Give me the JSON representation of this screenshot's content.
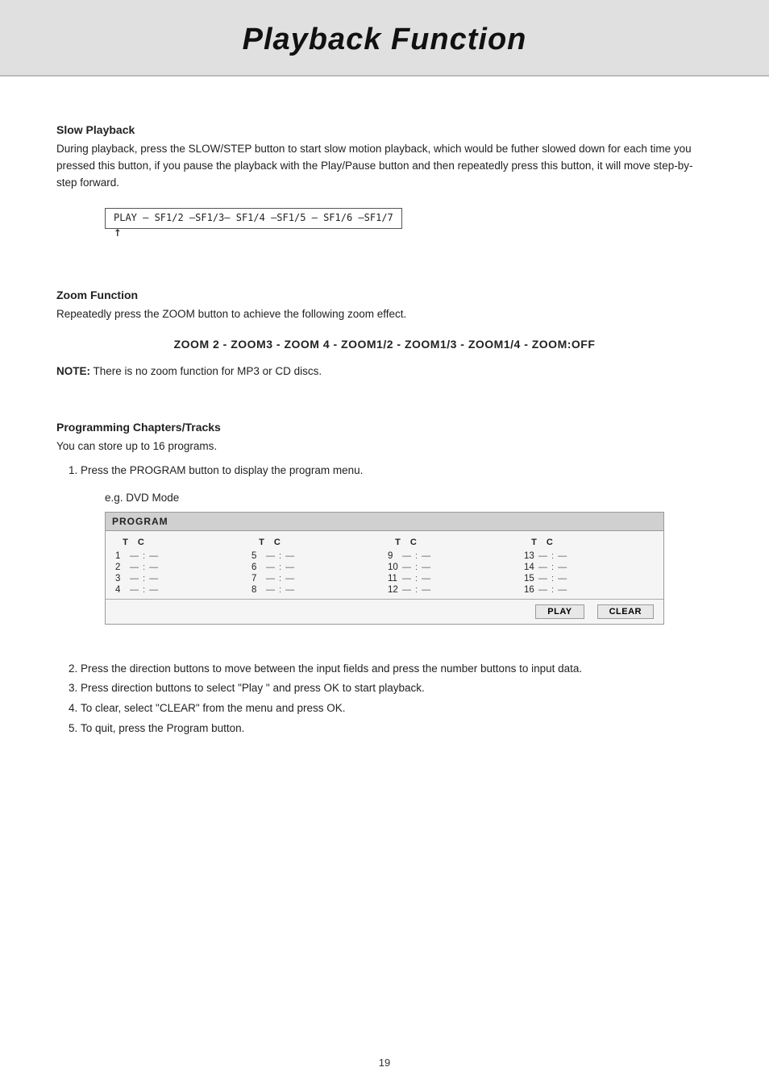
{
  "header": {
    "title": "Playback Function"
  },
  "sections": {
    "slow_playback": {
      "title": "Slow Playback",
      "body": "During playback, press the SLOW/STEP button to start slow motion playback, which would be futher slowed down for each time you pressed this button, if you pause the playback with the Play/Pause button and then repeatedly press this button, it will move step-by-step forward.",
      "diagram": "PLAY — SF1/2 —SF1/3— SF1/4 —SF1/5 — SF1/6 —SF1/7"
    },
    "zoom_function": {
      "title": "Zoom Function",
      "body": "Repeatedly press the ZOOM button to achieve the following zoom effect.",
      "zoom_line": "ZOOM 2 - ZOOM3 - ZOOM 4 - ZOOM1/2 - ZOOM1/3 - ZOOM1/4 - ZOOM:OFF",
      "note_label": "NOTE:",
      "note_text": " There is no zoom function for MP3 or CD discs."
    },
    "programming": {
      "title": "Programming Chapters/Tracks",
      "intro": "You can store up to 16 programs.",
      "step1": "Press the PROGRAM button to display the program menu.",
      "eg_label": "e.g. DVD Mode",
      "program_header": "PROGRAM",
      "col_headers": [
        "T C",
        "T C",
        "T C",
        "T C"
      ],
      "rows": [
        [
          "1  — : —",
          "5  — : —",
          "9   — : —",
          "13  — : —"
        ],
        [
          "2  — : —",
          "6  — : —",
          "10  — : —",
          "14  — : —"
        ],
        [
          "3  — : —",
          "7  — : —",
          "11  — : —",
          "15  — : —"
        ],
        [
          "4  — : —",
          "8  — : —",
          "12  — : —",
          "16  — : —"
        ]
      ],
      "btn_play": "PLAY",
      "btn_clear": "CLEAR",
      "step2": "Press the direction buttons to move between the input fields and press the number buttons to input data.",
      "step3": "Press direction buttons to select \"Play \" and press OK to start playback.",
      "step4": "To clear, select \"CLEAR\" from the menu and press OK.",
      "step5": "To quit, press the Program button."
    }
  },
  "page_number": "19"
}
